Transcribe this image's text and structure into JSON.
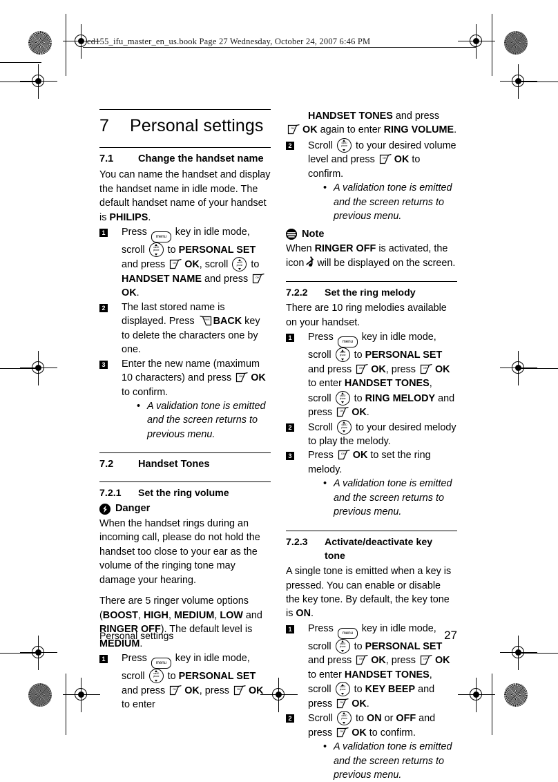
{
  "slug": {
    "text": "cd155_ifu_master_en_us.book  Page 27  Wednesday, October 24, 2007  6:46 PM"
  },
  "chapter": {
    "number": "7",
    "title": "Personal settings"
  },
  "footer": {
    "left": "Personal settings",
    "page": "27"
  },
  "keys": {
    "menu_label": "menu",
    "ok_label": "OK",
    "back_label": "BACK",
    "scroll_label_top": "call ID",
    "scroll_label_bottom": "phone"
  },
  "left_column": {
    "s71": {
      "number": "7.1",
      "title": "Change the handset name",
      "intro_1": "You can name the handset and display the handset name in idle mode. The default handset name of your handset is ",
      "intro_1_bold": "PHILIPS",
      "intro_1_end": ".",
      "step1": {
        "num": "1",
        "a": "Press",
        "b": "key in idle mode, scroll",
        "c": "to",
        "d": "PERSONAL SET",
        "e": "and press",
        "f": "OK",
        "g": ", scroll",
        "h": "to",
        "i": "HANDSET NAME",
        "j": "and press",
        "k": "OK",
        "l": "."
      },
      "step2": {
        "num": "2",
        "a": "The last stored name is displayed. Press",
        "b": "BACK",
        "c": "key to delete the characters one by one."
      },
      "step3": {
        "num": "3",
        "a": "Enter the new name (maximum 10 characters) and press",
        "b": "OK",
        "c": "to confirm.",
        "bullet": "A validation tone is emitted and the screen returns to previous menu."
      }
    },
    "s72": {
      "number": "7.2",
      "title": "Handset Tones"
    },
    "s721": {
      "number": "7.2.1",
      "title": "Set the ring volume",
      "danger_label": "Danger",
      "danger_icon": "lightning-bolt-badge",
      "danger_text": "When the handset rings during an incoming call, please do not hold the handset too close to your ear as the volume of the ringing tone may damage your hearing.",
      "options_pre": "There are 5 ringer volume options (",
      "options": [
        "BOOST",
        "HIGH",
        "MEDIUM",
        "LOW"
      ],
      "options_and": " and ",
      "options_last": "RINGER OFF",
      "options_post": "). The default level is ",
      "default_level": "MEDIUM",
      "options_end": ".",
      "step1": {
        "num": "1",
        "a": "Press",
        "b": "key in idle mode, scroll",
        "c": "to",
        "d": "PERSONAL SET",
        "e": "and press",
        "f": "OK",
        "g": ", press",
        "h": "OK",
        "i": "to enter"
      }
    }
  },
  "right_column": {
    "s721_cont": {
      "a": "HANDSET TONES",
      "b": "and press",
      "c": "OK",
      "d": "again to enter",
      "e": "RING VOLUME",
      "f": ".",
      "step2": {
        "num": "2",
        "a": "Scroll",
        "b": "to your desired volume level and press",
        "c": "OK",
        "d": "to confirm.",
        "bullet": "A validation tone is emitted and the screen returns to previous menu."
      },
      "note_label": "Note",
      "note_icon": "note-lines-badge",
      "note_a": "When",
      "note_b": "RINGER OFF",
      "note_c": "is activated, the icon",
      "note_icon_name": "ringer-off-icon",
      "note_d": "will be displayed on the screen."
    },
    "s722": {
      "number": "7.2.2",
      "title": "Set the ring melody",
      "intro": "There are 10 ring melodies available on your handset.",
      "step1": {
        "num": "1",
        "a": "Press",
        "b": "key in idle mode, scroll",
        "c": "to",
        "d": "PERSONAL SET",
        "e": "and press",
        "f": "OK",
        "g": ", press",
        "h": "OK",
        "i": "to enter",
        "j": "HANDSET TONES",
        "k": ", scroll",
        "l": "to",
        "m": "RING MELODY",
        "n": "and press",
        "o": "OK",
        "p": "."
      },
      "step2": {
        "num": "2",
        "a": "Scroll",
        "b": "to your desired melody to play the melody."
      },
      "step3": {
        "num": "3",
        "a": "Press",
        "b": "OK",
        "c": "to set the ring melody.",
        "bullet": "A validation tone is emitted and the screen returns to previous menu."
      }
    },
    "s723": {
      "number": "7.2.3",
      "title_line1": "Activate/deactivate key",
      "title_line2": "tone",
      "intro_a": "A single tone is emitted when a key is pressed. You can enable or disable the key tone. By default, the key tone is ",
      "intro_b": "ON",
      "intro_c": ".",
      "step1": {
        "num": "1",
        "a": "Press",
        "b": "key in idle mode, scroll",
        "c": "to",
        "d": "PERSONAL SET",
        "e": "and press",
        "f": "OK",
        "g": ", press",
        "h": "OK",
        "i": "to enter",
        "j": "HANDSET TONES",
        "k": ", scroll",
        "l": "to",
        "m": "KEY BEEP",
        "n": "and press",
        "o": "OK",
        "p": "."
      },
      "step2": {
        "num": "2",
        "a": "Scroll",
        "b": "to",
        "c": "ON",
        "d": "or",
        "e": "OFF",
        "f": "and press",
        "g": "OK",
        "h": "to confirm.",
        "bullet": "A validation tone is emitted and the screen returns to previous menu."
      }
    }
  }
}
